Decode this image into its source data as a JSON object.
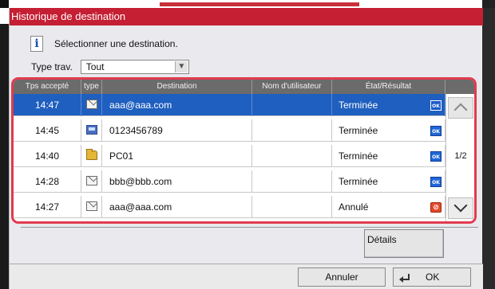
{
  "window": {
    "title": "Historique de destination",
    "instruction": "Sélectionner une destination.",
    "info_icon_glyph": "i"
  },
  "filter": {
    "label": "Type trav.",
    "selected": "Tout"
  },
  "table": {
    "columns": [
      "Tps accepté",
      "type",
      "Destination",
      "Nom d'utilisateur",
      "État/Résultat"
    ],
    "rows": [
      {
        "time": "14:47",
        "type_icon": "email-icon",
        "destination": "aaa@aaa.com",
        "user": "",
        "status": "Terminée",
        "status_icon": "ok-icon",
        "selected": true
      },
      {
        "time": "14:45",
        "type_icon": "fax-icon",
        "destination": "0123456789",
        "user": "",
        "status": "Terminée",
        "status_icon": "ok-icon",
        "selected": false
      },
      {
        "time": "14:40",
        "type_icon": "folder-icon",
        "destination": "PC01",
        "user": "",
        "status": "Terminée",
        "status_icon": "ok-icon",
        "selected": false
      },
      {
        "time": "14:28",
        "type_icon": "email-icon",
        "destination": "bbb@bbb.com",
        "user": "",
        "status": "Terminée",
        "status_icon": "ok-icon",
        "selected": false
      },
      {
        "time": "14:27",
        "type_icon": "email-icon",
        "destination": "aaa@aaa.com",
        "user": "",
        "status": "Annulé",
        "status_icon": "cancel-icon",
        "selected": false
      }
    ],
    "ok_badge": "OK",
    "page_indicator": "1/2"
  },
  "buttons": {
    "details": "Détails",
    "cancel": "Annuler",
    "ok": "OK"
  },
  "colors": {
    "title_bar": "#c51f33",
    "selected_row": "#1f5fbf",
    "frame_highlight": "#e23a4e"
  }
}
